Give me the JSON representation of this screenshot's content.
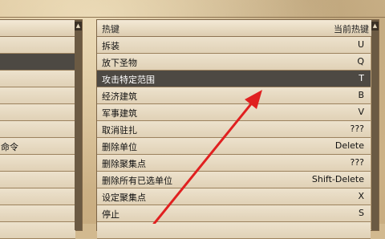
{
  "right_panel": {
    "header": {
      "hotkey": "热键",
      "current": "当前热键"
    },
    "rows": [
      {
        "label": "拆装",
        "key": "U"
      },
      {
        "label": "放下圣物",
        "key": "Q"
      },
      {
        "label": "攻击特定范围",
        "key": "T",
        "selected": true
      },
      {
        "label": "经济建筑",
        "key": "B"
      },
      {
        "label": "军事建筑",
        "key": "V"
      },
      {
        "label": "取消驻扎",
        "key": "???"
      },
      {
        "label": "删除单位",
        "key": "Delete"
      },
      {
        "label": "删除聚集点",
        "key": "???"
      },
      {
        "label": "删除所有已选单位",
        "key": "Shift-Delete"
      },
      {
        "label": "设定聚集点",
        "key": "X"
      },
      {
        "label": "停止",
        "key": "S"
      },
      {
        "label": "",
        "key": ""
      }
    ]
  },
  "left_panel": {
    "rows": [
      {
        "label": ""
      },
      {
        "label": "",
        "selected": true
      },
      {
        "label": ""
      },
      {
        "label": ""
      },
      {
        "label": ""
      },
      {
        "label": ""
      },
      {
        "label": "命令"
      },
      {
        "label": ""
      },
      {
        "label": ""
      },
      {
        "label": ""
      },
      {
        "label": ""
      },
      {
        "label": ""
      }
    ]
  },
  "icons": {
    "scroll_up": "scroll-up-arrow-icon",
    "pointer_arrow": "red-arrow-annotation"
  },
  "colors": {
    "selected_row": "#4d4943",
    "arrow": "#e02020"
  }
}
